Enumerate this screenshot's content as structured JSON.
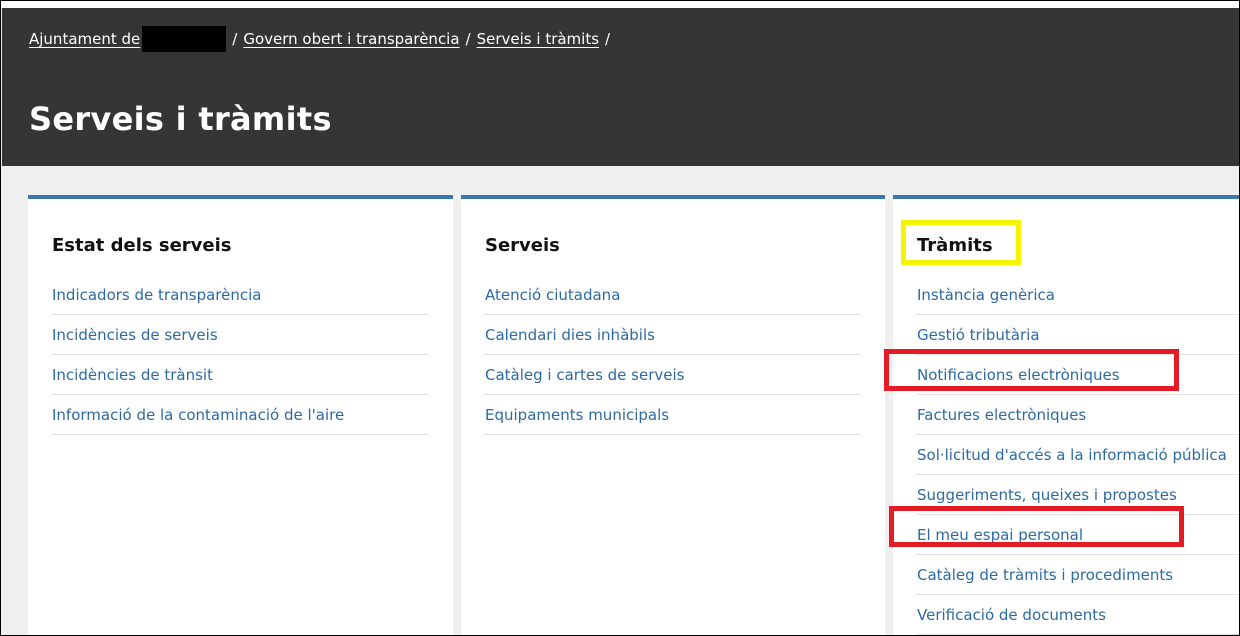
{
  "breadcrumb": {
    "home": "Ajuntament de",
    "item2": "Govern obert i transparència",
    "item3": "Serveis i tràmits",
    "separator": "/"
  },
  "page_title": "Serveis i tràmits",
  "columns": [
    {
      "title": "Estat dels serveis",
      "items": [
        "Indicadors de transparència",
        "Incidències de serveis",
        "Incidències de trànsit",
        "Informació de la contaminació de l'aire"
      ]
    },
    {
      "title": "Serveis",
      "items": [
        "Atenció ciutadana",
        "Calendari dies inhàbils",
        "Catàleg i cartes de serveis",
        "Equipaments municipals"
      ]
    },
    {
      "title": "Tràmits",
      "items": [
        "Instància genèrica",
        "Gestió tributària",
        "Notificacions electròniques",
        "Factures electròniques",
        "Sol·licitud d'accés a la informació pública",
        "Suggeriments, queixes i propostes",
        "El meu espai personal",
        "Catàleg de tràmits i procediments",
        "Verificació de documents"
      ]
    }
  ],
  "colors": {
    "header_bg": "#353535",
    "accent_border": "#3b78b0",
    "link": "#2d6aa3",
    "highlight_yellow": "#f5f500",
    "highlight_red": "#e21b24"
  }
}
